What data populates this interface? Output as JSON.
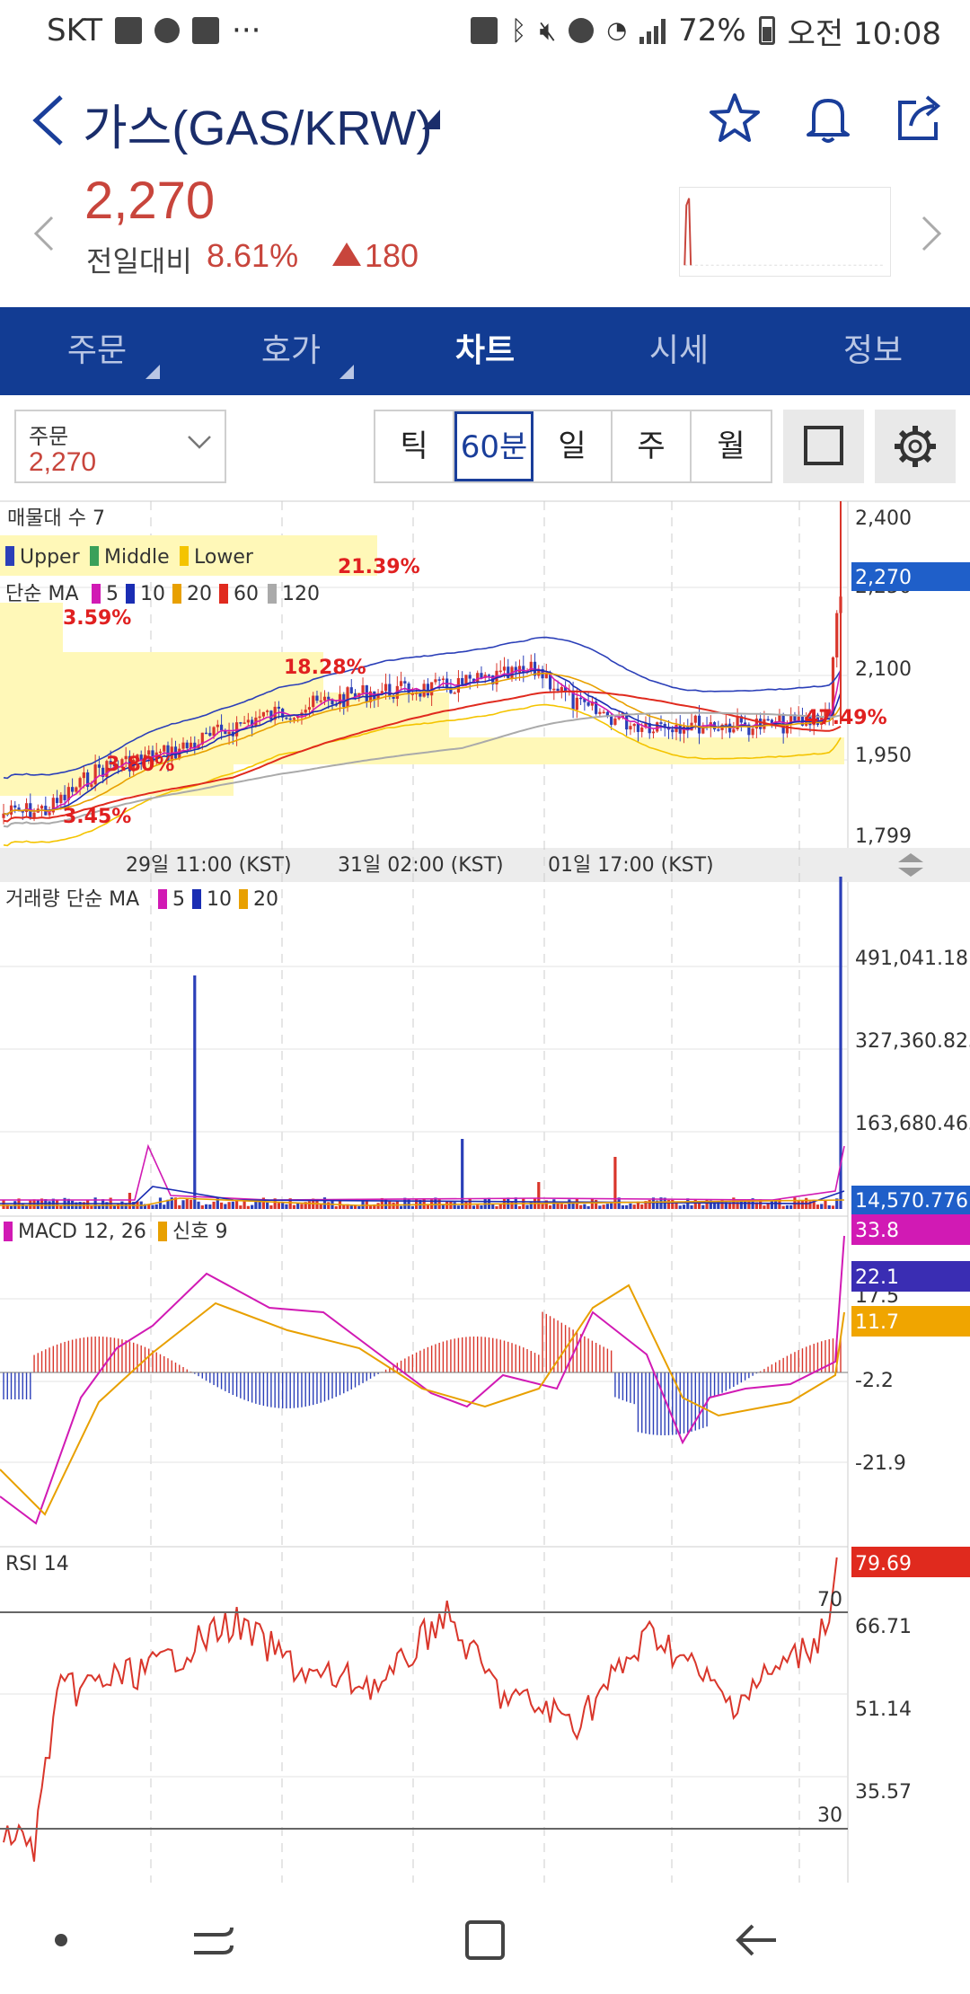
{
  "status_bar": {
    "carrier": "SKT",
    "battery": "72%",
    "time": "오전 10:08",
    "more": "···"
  },
  "header": {
    "title": "가스(GAS/KRW)",
    "icons": [
      "back-icon",
      "star-icon",
      "bell-icon",
      "share-icon"
    ]
  },
  "price": {
    "current": "2,270",
    "change_label": "전일대비",
    "change_pct": "8.61%",
    "change_amount": "180",
    "color": "#c8453c"
  },
  "tabs": [
    {
      "label": "주문",
      "active": false
    },
    {
      "label": "호가",
      "active": false
    },
    {
      "label": "차트",
      "active": true
    },
    {
      "label": "시세",
      "active": false
    },
    {
      "label": "정보",
      "active": false
    }
  ],
  "toolbar": {
    "order_label": "주문",
    "order_value": "2,270",
    "periods": [
      {
        "label": "틱",
        "active": false
      },
      {
        "label": "60분",
        "active": true
      },
      {
        "label": "일",
        "active": false
      },
      {
        "label": "주",
        "active": false
      },
      {
        "label": "월",
        "active": false
      }
    ]
  },
  "chart": {
    "price_panel": {
      "indicator_title": "매물대 수 7",
      "bands": [
        "Upper",
        "Middle",
        "Lower"
      ],
      "ma_label": "단순 MA",
      "ma_periods": [
        "5",
        "10",
        "20",
        "60",
        "120"
      ],
      "pct_labels": [
        "21.39%",
        "3.59%",
        "18.28%",
        "3.80%",
        "3.45%",
        "47.49%"
      ],
      "y_ticks": [
        "2,400",
        "2,250",
        "2,100",
        "1,950",
        "1,799"
      ],
      "current_marker": "2,270",
      "x_ticks": [
        "29일 11:00 (KST)",
        "31일 02:00 (KST)",
        "01일 17:00 (KST)"
      ]
    },
    "volume_panel": {
      "title": "거래량 단순 MA",
      "ma_periods": [
        "5",
        "10",
        "20"
      ],
      "y_ticks": [
        "491,041.181",
        "327,360.823",
        "163,680.465"
      ],
      "current_marker": "14,570.776"
    },
    "macd_panel": {
      "title": "MACD 12, 26",
      "signal": "신호 9",
      "y_ticks": [
        "17.5",
        "-2.2",
        "-21.9"
      ],
      "macd_marker": "33.8",
      "signal_marker": "22.1",
      "hist_marker": "11.7"
    },
    "rsi_panel": {
      "title": "RSI 14",
      "y_ticks": [
        "66.71",
        "51.14",
        "35.57"
      ],
      "level_high": "70",
      "level_low": "30",
      "current_marker": "79.69"
    },
    "colors": {
      "up": "#d9362b",
      "down": "#2b3fb8",
      "marker_blue": "#1f5fc9",
      "marker_magenta": "#d11ab4",
      "marker_indigo": "#3a2db3",
      "marker_orange": "#f0a500",
      "marker_red": "#e02a1e"
    }
  },
  "navbar": {
    "icons": [
      "dot-icon",
      "recent-apps-icon",
      "home-icon",
      "back-nav-icon"
    ]
  }
}
